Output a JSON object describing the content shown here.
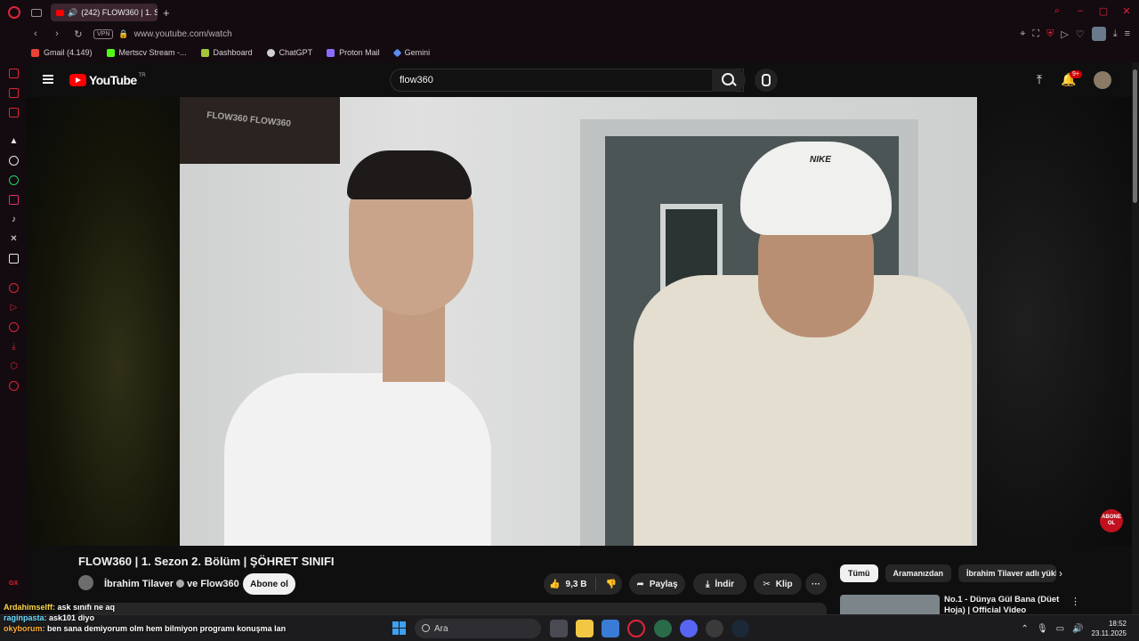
{
  "browser": {
    "tab_title": "(242) FLOW360 | 1. Se",
    "new_tab": "+",
    "url": "www.youtube.com/watch",
    "vpn_label": "VPN"
  },
  "bookmarks": [
    {
      "label": "Gmail (4.149)",
      "color": "#ea4335"
    },
    {
      "label": "Mertscv Stream -...",
      "color": "#53fc18"
    },
    {
      "label": "Dashboard",
      "color": "#a3c639"
    },
    {
      "label": "ChatGPT",
      "color": "#d0d0d0"
    },
    {
      "label": "Proton Mail",
      "color": "#8a6cff"
    },
    {
      "label": "Gemini",
      "color": "#5b8def"
    }
  ],
  "youtube": {
    "logo_text": "YouTube",
    "country_code": "TR",
    "search_value": "flow360",
    "notification_badge": "9+",
    "accent": "#ff0000"
  },
  "video": {
    "poster_text": "FLOW360 FLOW360",
    "brand_text": "NIKE",
    "subscribe_badge": "ABONE OL"
  },
  "info": {
    "title": "FLOW360 | 1. Sezon 2. Bölüm | ŞÖHRET SINIFI",
    "channel_primary": "İbrahim Tilaver",
    "channel_joiner": "ve",
    "channel_secondary": "Flow360",
    "subscribe_label": "Abone ol",
    "like_count": "9,3 B",
    "share_label": "Paylaş",
    "download_label": "İndir",
    "clip_label": "Klip",
    "more_label": "···"
  },
  "chips": [
    "Tümü",
    "Aramanızdan",
    "İbrahim Tilaver adlı yükl"
  ],
  "recommendation": {
    "title": "No.1 - Dünya Gül Bana (Düet Hoja) | Official Video"
  },
  "chat": [
    {
      "user": "Ardahimselff:",
      "message": "ask sınıfı ne aq"
    },
    {
      "user": "raginpasta:",
      "message": "ask101 diyo"
    },
    {
      "user": "okyborum:",
      "message": "ben sana demiyorum olm hem bilmiyon programı konuşma lan"
    }
  ],
  "taskbar": {
    "search_placeholder": "Ara",
    "time": "18:52",
    "date": "23.11.2025"
  }
}
